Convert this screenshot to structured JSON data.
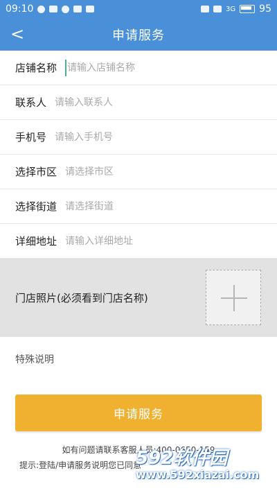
{
  "status_bar": {
    "time": "09:10",
    "battery": "95",
    "signal": "3G"
  },
  "nav": {
    "back_glyph": "<",
    "title": "申请服务"
  },
  "form": {
    "rows": [
      {
        "label": "店铺名称",
        "placeholder": "请输入店铺名称",
        "value": ""
      },
      {
        "label": "联系人",
        "placeholder": "请输入联系人",
        "value": ""
      },
      {
        "label": "手机号",
        "placeholder": "请输入手机号",
        "value": ""
      },
      {
        "label": "选择市区",
        "placeholder": "请选择市区",
        "value": ""
      },
      {
        "label": "选择街道",
        "placeholder": "请选择街道",
        "value": ""
      },
      {
        "label": "详细地址",
        "placeholder": "请输入详细地址",
        "value": ""
      }
    ]
  },
  "photo": {
    "label": "门店照片(必须看到门店名称)",
    "add_icon": "plus-icon"
  },
  "special_note_label": "特殊说明",
  "submit_label": "申请服务",
  "notes": {
    "line1": "如有问题请联系客服人员:400-0650-159",
    "line2": "提示:登陆/申请服务说明您已同意"
  },
  "watermark": {
    "top": "592软件园",
    "bottom": "www.592xiazai.com"
  },
  "colors": {
    "primary": "#4a90d9",
    "accent": "#f0b030",
    "photo_bg": "#e2e2e2"
  }
}
